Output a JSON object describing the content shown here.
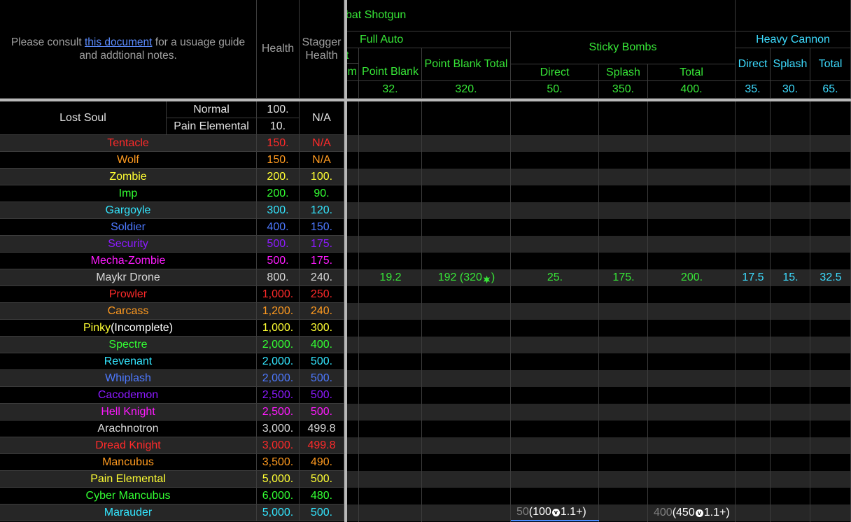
{
  "header": {
    "note_prefix": "Please consult ",
    "note_link": "this document",
    "note_suffix": " for a usuage guide and addtional notes.",
    "health_label": "Health",
    "stagger_label": "Stagger Health",
    "weapon_group": "bat Shotgun",
    "full_auto_label": "Full Auto",
    "partial_col_top": "t",
    "partial_col_bottom": "m",
    "point_blank_label": "Point Blank",
    "point_blank_total_label": "Point Blank Total",
    "sticky_bombs_label": "Sticky Bombs",
    "direct_label": "Direct",
    "splash_label": "Splash",
    "total_label": "Total",
    "heavy_cannon_label": "Heavy Cannon",
    "hc_direct_label": "Direct",
    "hc_splash_label": "Splash",
    "hc_total_label": "Total",
    "base_values": {
      "point_blank": "32.",
      "point_blank_total": "320.",
      "sticky_direct": "50.",
      "sticky_splash": "350.",
      "sticky_total": "400.",
      "hc_direct": "35.",
      "hc_splash": "30.",
      "hc_total": "65."
    }
  },
  "lost_soul": {
    "name": "Lost Soul",
    "variant_normal": "Normal",
    "health_normal": "100.",
    "variant_pe": "Pain Elemental",
    "health_pe": "10.",
    "stagger": "N/A"
  },
  "enemies": [
    {
      "name": "Tentacle",
      "health": "150.",
      "stagger": "N/A",
      "color": "#ff2a2a"
    },
    {
      "name": "Wolf",
      "health": "150.",
      "stagger": "N/A",
      "color": "#ff9a1f"
    },
    {
      "name": "Zombie",
      "health": "200.",
      "stagger": "100.",
      "color": "#ffff33"
    },
    {
      "name": "Imp",
      "health": "200.",
      "stagger": "90.",
      "color": "#33ff33"
    },
    {
      "name": "Gargoyle",
      "health": "300.",
      "stagger": "120.",
      "color": "#33e6ff"
    },
    {
      "name": "Soldier",
      "health": "400.",
      "stagger": "150.",
      "color": "#4d79ff"
    },
    {
      "name": "Security",
      "health": "500.",
      "stagger": "175.",
      "color": "#8c1aff"
    },
    {
      "name": "Mecha-Zombie",
      "health": "500.",
      "stagger": "175.",
      "color": "#ff1aff"
    },
    {
      "name": "Maykr Drone",
      "health": "800.",
      "stagger": "240.",
      "color": "#d9d9d9"
    },
    {
      "name": "Prowler",
      "health": "1,000.",
      "stagger": "250.",
      "color": "#ff2a2a"
    },
    {
      "name": "Carcass",
      "health": "1,200.",
      "stagger": "240.",
      "color": "#ff9a1f"
    },
    {
      "name": "Pinky",
      "name_suffix": "(Incomplete)",
      "health": "1,000.",
      "stagger": "300.",
      "color": "#ffff33"
    },
    {
      "name": "Spectre",
      "health": "2,000.",
      "stagger": "400.",
      "color": "#33ff33"
    },
    {
      "name": "Revenant",
      "health": "2,000.",
      "stagger": "500.",
      "color": "#33e6ff"
    },
    {
      "name": "Whiplash",
      "health": "2,000.",
      "stagger": "500.",
      "color": "#4d79ff"
    },
    {
      "name": "Cacodemon",
      "health": "2,500.",
      "stagger": "500.",
      "color": "#8c1aff"
    },
    {
      "name": "Hell Knight",
      "health": "2,500.",
      "stagger": "500.",
      "color": "#ff1aff"
    },
    {
      "name": "Arachnotron",
      "health": "3,000.",
      "stagger": "499.8",
      "color": "#d9d9d9"
    },
    {
      "name": "Dread Knight",
      "health": "3,000.",
      "stagger": "499.8",
      "color": "#ff2a2a"
    },
    {
      "name": "Mancubus",
      "health": "3,500.",
      "stagger": "490.",
      "color": "#ff9a1f"
    },
    {
      "name": "Pain Elemental",
      "health": "5,000.",
      "stagger": "500.",
      "color": "#ffff33"
    },
    {
      "name": "Cyber Mancubus",
      "health": "6,000.",
      "stagger": "480.",
      "color": "#33ff33"
    },
    {
      "name": "Marauder",
      "health": "5,000.",
      "stagger": "500.",
      "color": "#33e6ff"
    }
  ],
  "maykr_drone_damage": {
    "point_blank": "19.2",
    "point_blank_total_prefix": "192 (320",
    "point_blank_total_suffix": ")",
    "sticky_direct": "25.",
    "sticky_splash": "175.",
    "sticky_total": "200.",
    "hc_direct": "17.5",
    "hc_splash": "15.",
    "hc_total": "32.5"
  },
  "marauder_damage": {
    "sticky_direct_grey": "50",
    "sticky_direct_prefix": " (100 ",
    "sticky_direct_suffix": "1.1+)",
    "sticky_total_grey": "400",
    "sticky_total_prefix": " (450 ",
    "sticky_total_suffix": "1.1+)",
    "badge_glyph": "v"
  },
  "colors": {
    "header_text": "#37e637",
    "heavy_cannon_text": "#3ddcff",
    "note_text": "#a0a0a0",
    "link": "#5b8cff",
    "row_alt_bg": "#262626"
  }
}
